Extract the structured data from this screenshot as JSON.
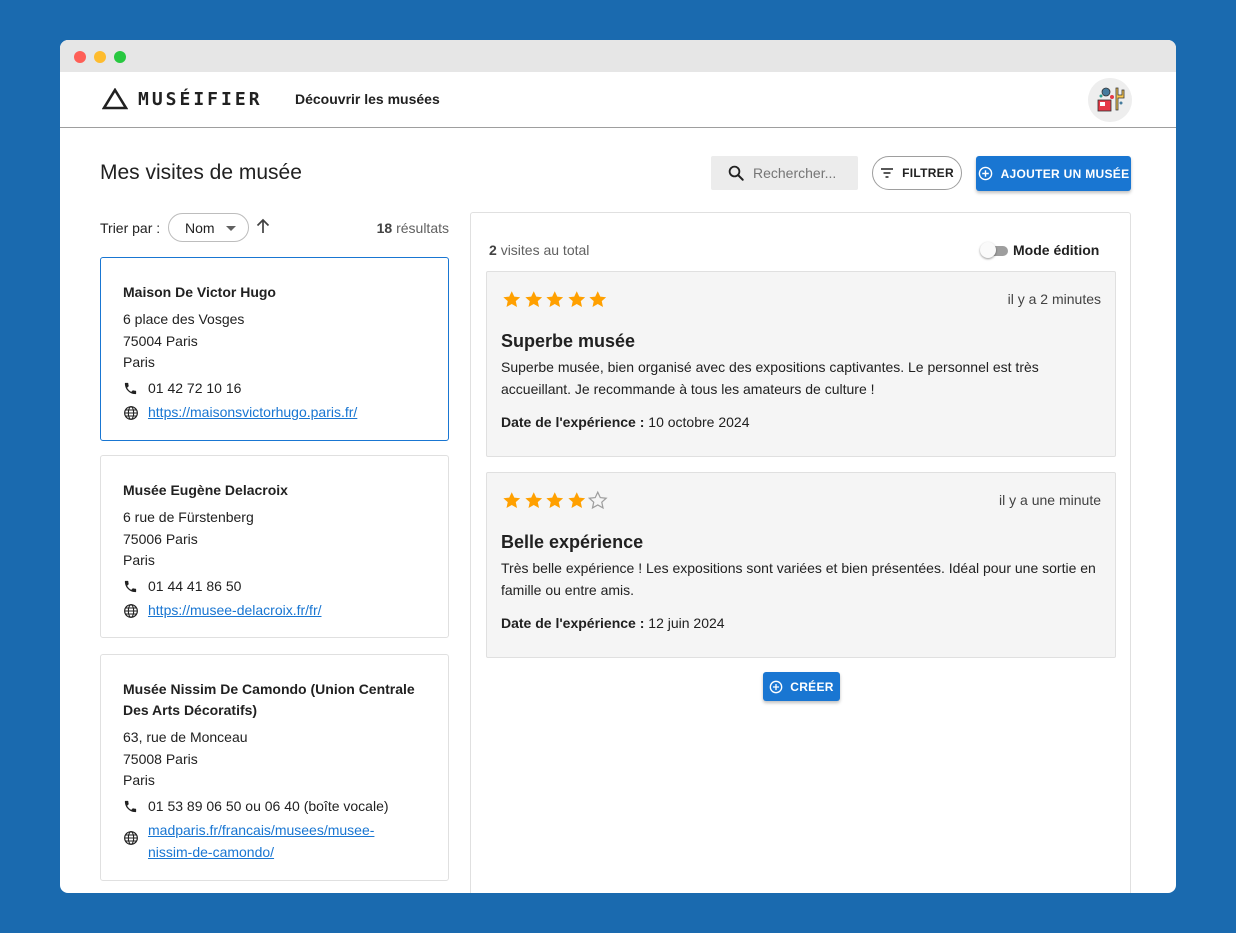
{
  "app": {
    "brand": "MUSÉIFIER",
    "nav_link": "Découvrir les musées"
  },
  "page": {
    "title": "Mes visites de musée",
    "search_placeholder": "Rechercher...",
    "filter_label": "FILTRER",
    "add_label": "AJOUTER UN MUSÉE"
  },
  "sort": {
    "label": "Trier par :",
    "selected": "Nom",
    "result_count": "18",
    "result_suffix": "résultats"
  },
  "museums": [
    {
      "name": "Maison De Victor Hugo",
      "street": "6 place des Vosges",
      "postal": "75004 Paris",
      "city": "Paris",
      "phone": "01 42 72 10 16",
      "website": "https://maisonsvictorhugo.paris.fr/"
    },
    {
      "name": "Musée Eugène Delacroix",
      "street": "6 rue de Fürstenberg",
      "postal": "75006 Paris",
      "city": "Paris",
      "phone": "01 44 41 86 50",
      "website": "https://musee-delacroix.fr/fr/"
    },
    {
      "name": "Musée Nissim De Camondo (Union Centrale Des Arts Décoratifs)",
      "street": "63, rue de Monceau",
      "postal": "75008 Paris",
      "city": "Paris",
      "phone": "01 53 89 06 50 ou 06 40 (boîte vocale)",
      "website": "madparis.fr/francais/musees/musee-nissim-de-camondo/"
    }
  ],
  "visits": {
    "total_count": "2",
    "total_suffix": "visites au total",
    "edit_mode_label": "Mode édition",
    "edit_mode_on": false,
    "create_label": "CRÉER",
    "date_label": "Date de l'expérience :"
  },
  "reviews": [
    {
      "rating": 5,
      "max_rating": 5,
      "time": "il y a 2 minutes",
      "title": "Superbe musée",
      "body": "Superbe musée, bien organisé avec des expositions captivantes. Le personnel est très accueillant. Je recommande à tous les amateurs de culture !",
      "date": "10 octobre 2024"
    },
    {
      "rating": 4,
      "max_rating": 5,
      "time": "il y a une minute",
      "title": "Belle expérience",
      "body": "Très belle expérience ! Les expositions sont variées et bien présentées. Idéal pour une sortie en famille ou entre amis.",
      "date": "12 juin 2024"
    }
  ],
  "colors": {
    "background": "#1a6aaf",
    "primary": "#1976d2",
    "star": "#ffa000",
    "star_empty": "#9e9e9e"
  }
}
